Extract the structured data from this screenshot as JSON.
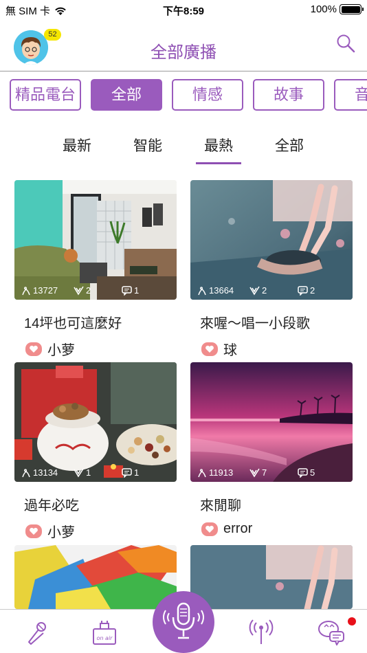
{
  "status_bar": {
    "carrier": "無 SIM 卡",
    "time": "下午8:59",
    "battery": "100%"
  },
  "header": {
    "title": "全部廣播",
    "badge_count": "52"
  },
  "categories": [
    {
      "label": "精品電台",
      "active": false
    },
    {
      "label": "全部",
      "active": true
    },
    {
      "label": "情感",
      "active": false
    },
    {
      "label": "故事",
      "active": false
    },
    {
      "label": "音",
      "active": false
    }
  ],
  "sub_tabs": [
    {
      "label": "最新"
    },
    {
      "label": "智能"
    },
    {
      "label": "最熱",
      "active": true
    },
    {
      "label": "全部"
    }
  ],
  "cards": [
    {
      "title": "14坪也可這麼好",
      "author": "小萝",
      "listens": "13727",
      "likes": "2",
      "comments": "1"
    },
    {
      "title": "來喔～唱一小段歌",
      "author": "球",
      "listens": "13664",
      "likes": "2",
      "comments": "2"
    },
    {
      "title": "過年必吃",
      "author": "小萝",
      "listens": "13134",
      "likes": "1",
      "comments": "1"
    },
    {
      "title": "來閒聊",
      "author": "error",
      "listens": "11913",
      "likes": "7",
      "comments": "5"
    }
  ],
  "colors": {
    "accent": "#9a5bbd",
    "badge": "#f5e600",
    "notification": "#e8101a",
    "heart_chip": "#f08c8c"
  },
  "tab_bar": {
    "icons": [
      "microphone-sing-icon",
      "on-air-icon",
      "record-mic-icon",
      "broadcast-antenna-icon",
      "chat-bubbles-icon"
    ]
  }
}
